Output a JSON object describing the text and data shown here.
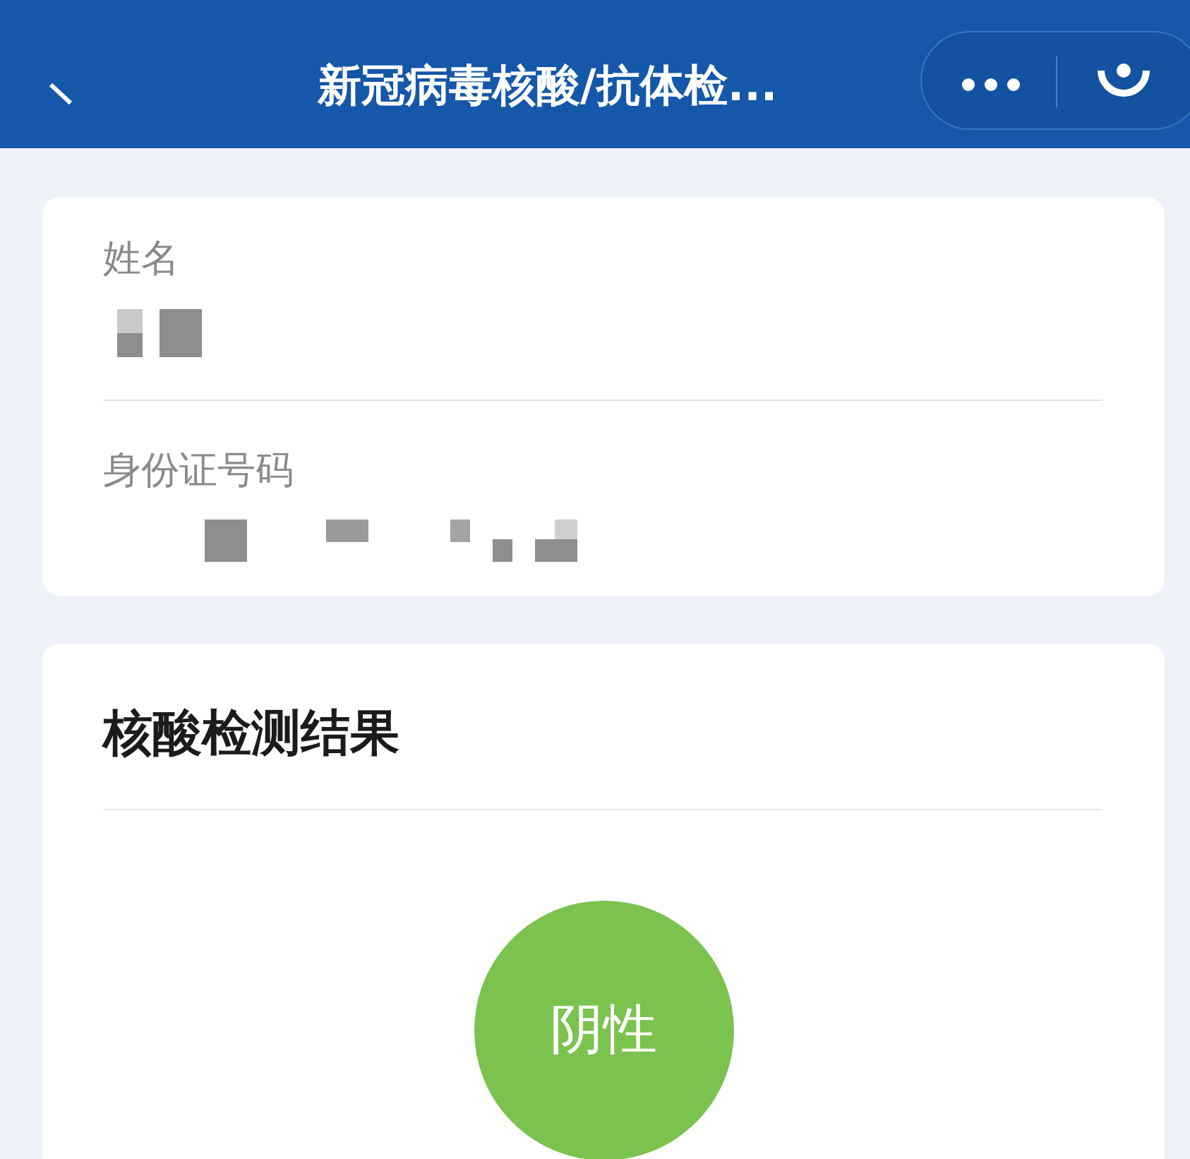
{
  "header": {
    "title": "新冠病毒核酸/抗体检..."
  },
  "info_fields": [
    {
      "label": "姓名",
      "redacted": true
    },
    {
      "label": "身份证号码",
      "redacted": true
    }
  ],
  "result_card": {
    "title": "核酸检测结果",
    "result": "阴性",
    "color": "#7bc24f"
  }
}
